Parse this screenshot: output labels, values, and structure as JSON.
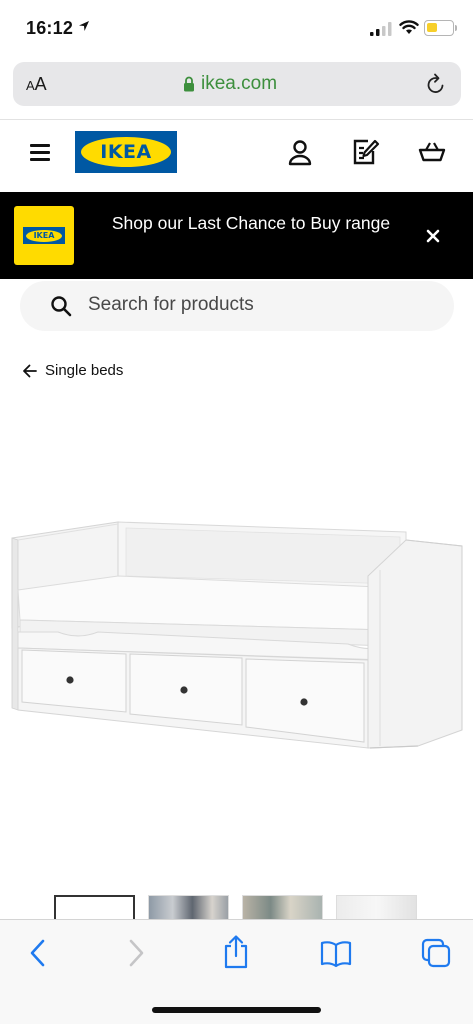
{
  "status_bar": {
    "time": "16:12",
    "battery_color": "#f7cf2a"
  },
  "browser": {
    "text_size_button": "AA",
    "url": "ikea.com",
    "url_color": "#3d8f3d"
  },
  "header": {
    "logo_text": "IKEA",
    "brand_blue": "#0058a3",
    "brand_yellow": "#ffdb00",
    "icons": [
      "menu-icon",
      "user-icon",
      "shopping-list-icon",
      "basket-icon"
    ]
  },
  "promo": {
    "logo_text": "IKEA",
    "message": "Shop our Last Chance to Buy range"
  },
  "search": {
    "placeholder": "Search for products"
  },
  "breadcrumb": {
    "label": "Single beds"
  },
  "product": {
    "image_alt": "white daybed with three drawers"
  },
  "gallery": {
    "thumbnail_count": 4,
    "selected_index": 0
  },
  "toolbar": {
    "icons": [
      "back-icon",
      "forward-icon",
      "share-icon",
      "bookmarks-icon",
      "tabs-icon"
    ],
    "accent": "#1f7aef"
  }
}
